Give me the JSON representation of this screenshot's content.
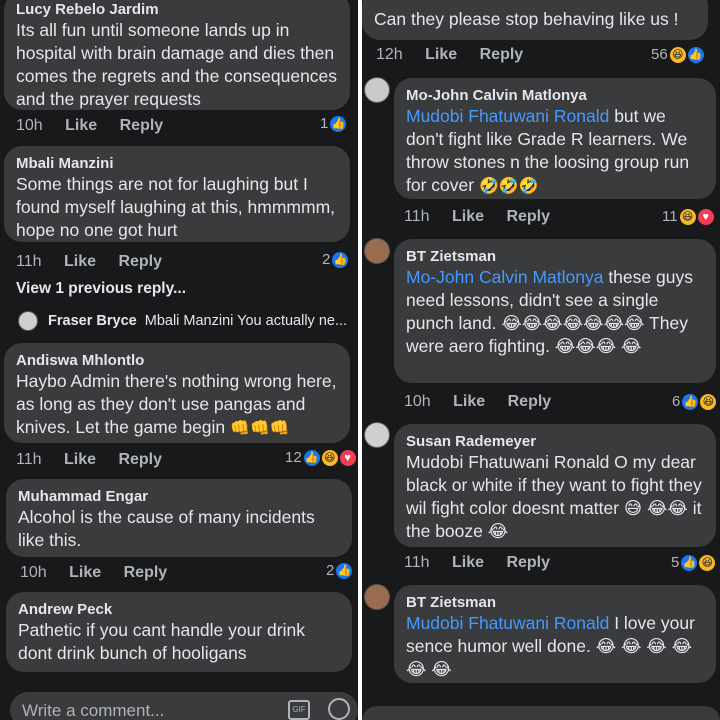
{
  "left": {
    "c1": {
      "author": "Lucy Rebelo Jardim",
      "text": "Its all fun until someone lands up in hospital with brain damage and dies then comes the regrets and the consequences and the prayer requests",
      "time": "10h",
      "like": "Like",
      "reply": "Reply",
      "count": "1"
    },
    "c2": {
      "author": "Mbali Manzini",
      "text": "Some things are not for laughing but I found myself laughing at this, hmmmmm, hope no one got hurt",
      "time": "11h",
      "like": "Like",
      "reply": "Reply",
      "count": "2"
    },
    "view_previous": "View 1 previous reply...",
    "reply_preview": {
      "author": "Fraser Bryce",
      "text": "Mbali Manzini You actually ne..."
    },
    "c3": {
      "author": "Andiswa Mhlontlo",
      "text": "Haybo Admin there's nothing wrong here, as long as they don't use pangas and knives. Let the game begin",
      "emoji": "👊👊👊",
      "time": "11h",
      "like": "Like",
      "reply": "Reply",
      "count": "12"
    },
    "c4": {
      "author": "Muhammad Engar",
      "text": "Alcohol is the cause of many incidents like this.",
      "time": "10h",
      "like": "Like",
      "reply": "Reply",
      "count": "2"
    },
    "c5": {
      "author": "Andrew Peck",
      "text": "Pathetic if you cant handle your drink dont drink bunch of hooligans"
    },
    "composer_placeholder": "Write a comment..."
  },
  "right": {
    "c0": {
      "text": "Can they please stop behaving like us !",
      "time": "12h",
      "like": "Like",
      "reply": "Reply",
      "count": "56"
    },
    "c1": {
      "author": "Mo-John Calvin Matlonya",
      "mention": "Mudobi Fhatuwani Ronald",
      "text": " but we don't fight like Grade R learners. We throw stones n the loosing group run for cover",
      "emoji": "🤣🤣🤣",
      "time": "11h",
      "like": "Like",
      "reply": "Reply",
      "count": "11"
    },
    "c2": {
      "author": "BT Zietsman",
      "mention": "Mo-John Calvin Matlonya",
      "text": " these guys need lessons, didn't see a single punch land. 😂😂😂😂😂😂😂 They were aero fighting. 😂😂😂 😂",
      "time": "10h",
      "like": "Like",
      "reply": "Reply",
      "count": "6"
    },
    "c3": {
      "author": "Susan Rademeyer",
      "text": "Mudobi Fhatuwani Ronald O my dear black or white if they want to fight they wil fight color doesnt matter 😅 😂😂 it the booze 😂",
      "time": "11h",
      "like": "Like",
      "reply": "Reply",
      "count": "5"
    },
    "c4": {
      "author": "BT Zietsman",
      "mention": "Mudobi Fhatuwani Ronald",
      "text": " I love your sence humor well done. 😂 😂 😂 😂 😂 😂"
    }
  }
}
